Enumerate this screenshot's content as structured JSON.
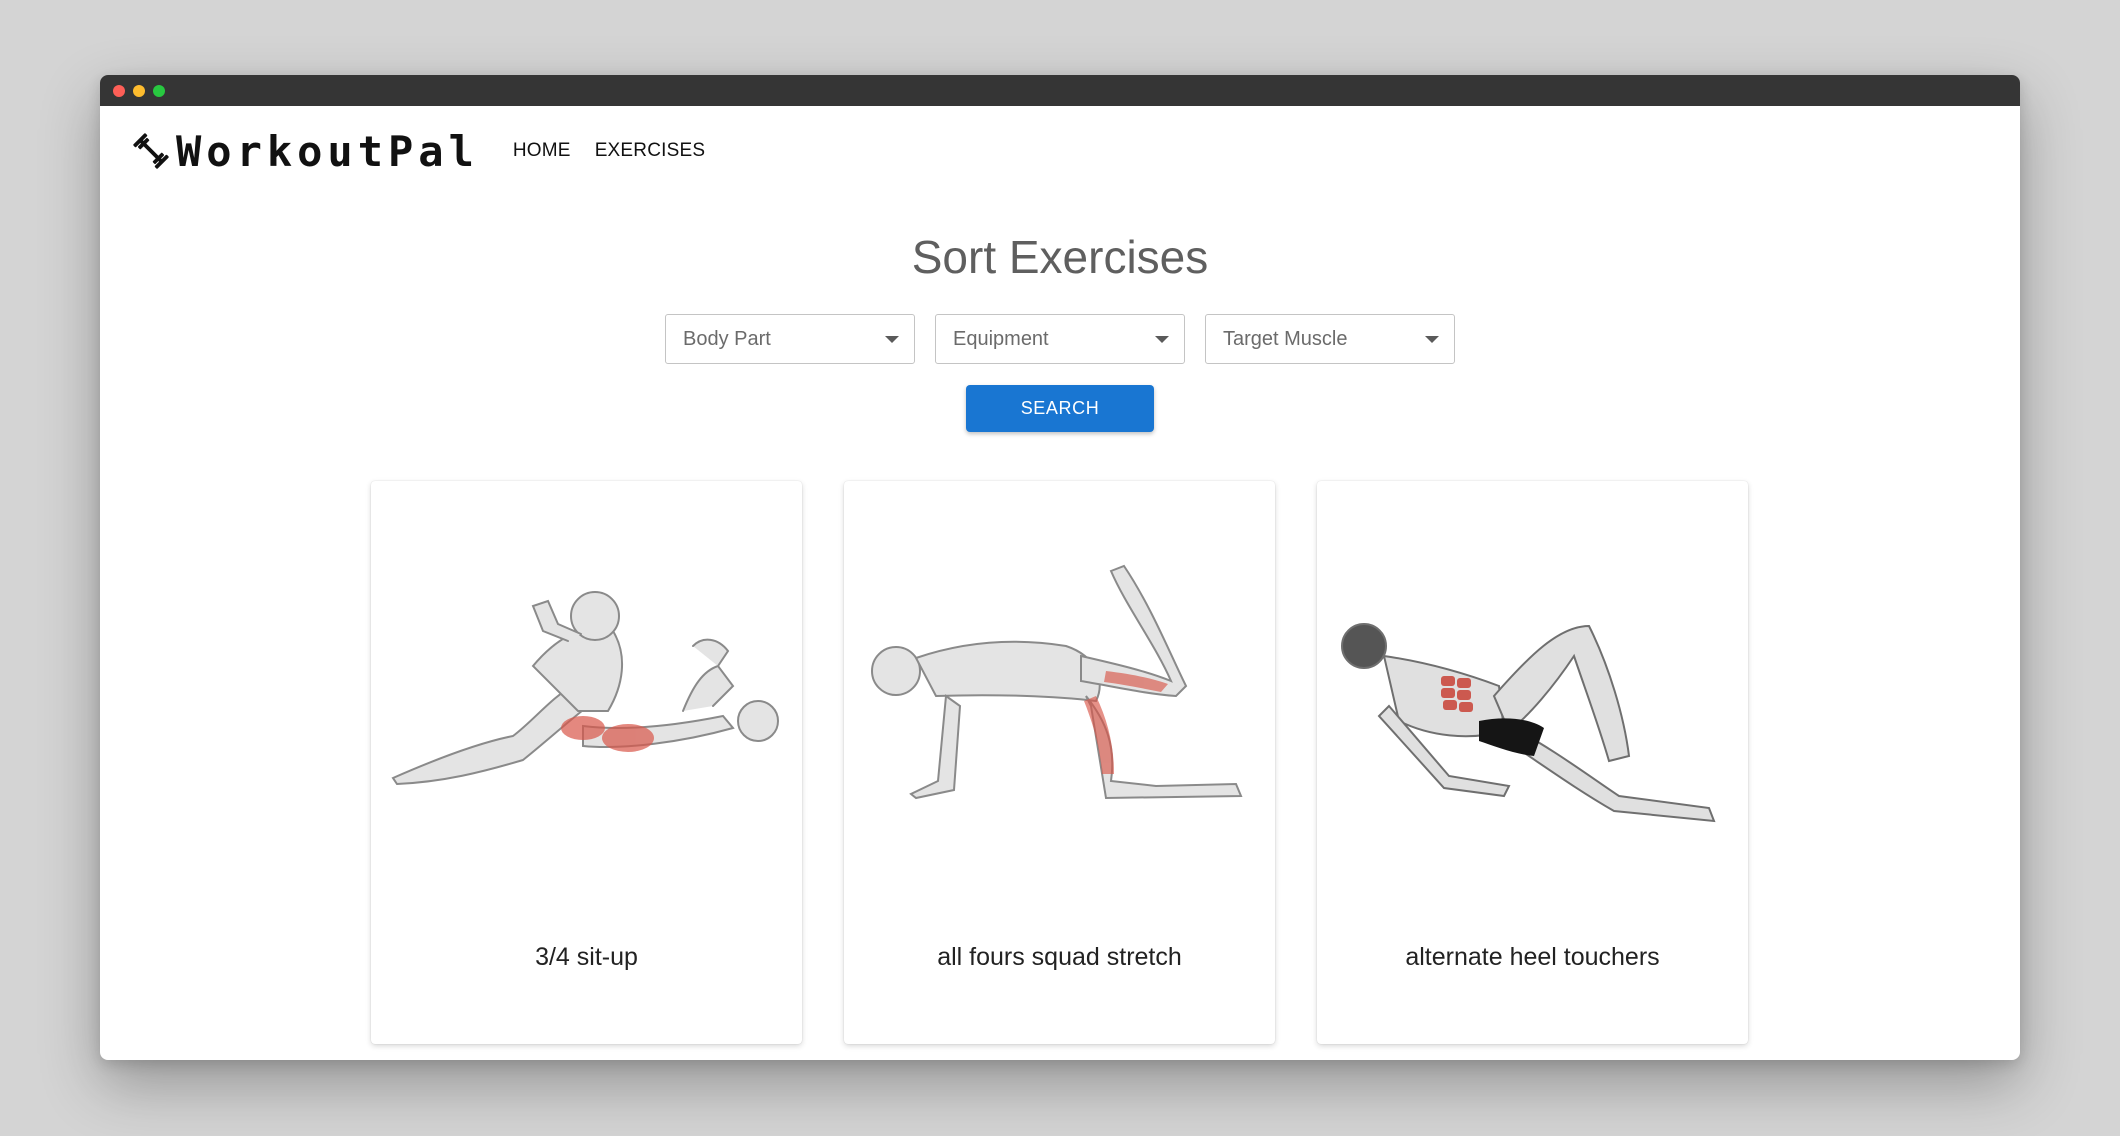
{
  "window": {
    "dot_colors": [
      "#fe5f57",
      "#febc2e",
      "#28c840"
    ]
  },
  "brand": {
    "name": "WorkoutPal",
    "icon": "dumbbell-icon"
  },
  "nav": {
    "links": [
      "HOME",
      "EXERCISES"
    ]
  },
  "page": {
    "title": "Sort Exercises"
  },
  "filters": {
    "body_part": "Body Part",
    "equipment": "Equipment",
    "target_muscle": "Target Muscle"
  },
  "search_button": "SEARCH",
  "colors": {
    "primary": "#1976d2",
    "muscle_highlight": "#d9574a"
  },
  "exercises": [
    {
      "name": "3/4 sit-up",
      "image": "sit-up-illustration"
    },
    {
      "name": "all fours squad stretch",
      "image": "squad-stretch-illustration"
    },
    {
      "name": "alternate heel touchers",
      "image": "heel-touchers-illustration"
    }
  ]
}
